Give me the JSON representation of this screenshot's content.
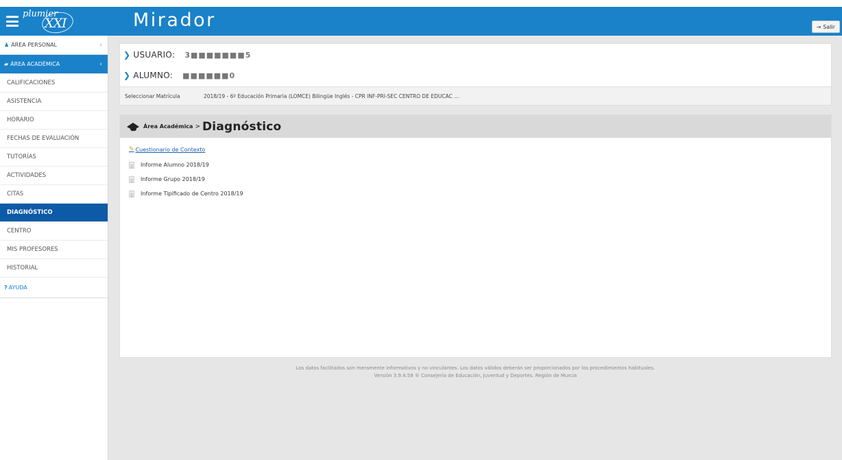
{
  "header": {
    "logo_text": "plumier",
    "logo_suffix": "XXI",
    "app_title": "Mirador",
    "exit_label": "Salir",
    "brand_color": "#1a82c9"
  },
  "sidebar": {
    "personal": {
      "label": "ÁREA PERSONAL",
      "chevron": "‹"
    },
    "academica": {
      "label": "ÁREA ACADÉMICA",
      "chevron": "‹"
    },
    "items": [
      {
        "label": "CALIFICACIONES"
      },
      {
        "label": "ASISTENCIA"
      },
      {
        "label": "HORARIO"
      },
      {
        "label": "FECHAS DE EVALUACIÓN"
      },
      {
        "label": "TUTORÍAS"
      },
      {
        "label": "ACTIVIDADES"
      },
      {
        "label": "CITAS"
      },
      {
        "label": "DIAGNÓSTICO",
        "active": true
      },
      {
        "label": "CENTRO"
      },
      {
        "label": "MIS PROFESORES"
      },
      {
        "label": "HISTORIAL"
      }
    ],
    "help": {
      "icon": "?",
      "label": "AYUDA"
    },
    "active_color": "#0d5aa7"
  },
  "user": {
    "usuario_label": "USUARIO:",
    "usuario_value": "3■■■■■■■5",
    "alumno_label": "ALUMNO:",
    "alumno_value": "■■■■■■0",
    "matricula_label": "Seleccionar Matrícula",
    "matricula_value": "2018/19 - 6º Educación Primaria (LOMCE) Bilingüe Inglés - CPR INF-PRI-SEC CENTRO DE EDUCAC ..."
  },
  "content": {
    "breadcrumb_parent": "Área Académica",
    "breadcrumb_sep": ">",
    "breadcrumb_current": "Diagnóstico",
    "cuestionario_label": "Cuestionario de Contexto",
    "reports": [
      {
        "label": "Informe Alumno 2018/19"
      },
      {
        "label": "Informe Grupo 2018/19"
      },
      {
        "label": "Informe Tipificado de Centro 2018/19"
      }
    ]
  },
  "footer": {
    "line1": "Los datos facilitados son meramente informativos y no vinculantes. Los datos válidos deberán ser proporcionados por los procedimientos habituales.",
    "line2": "Versión 3.9.4.58 ® Consejería de Educación, Juventud y Deportes. Región de Murcia"
  }
}
